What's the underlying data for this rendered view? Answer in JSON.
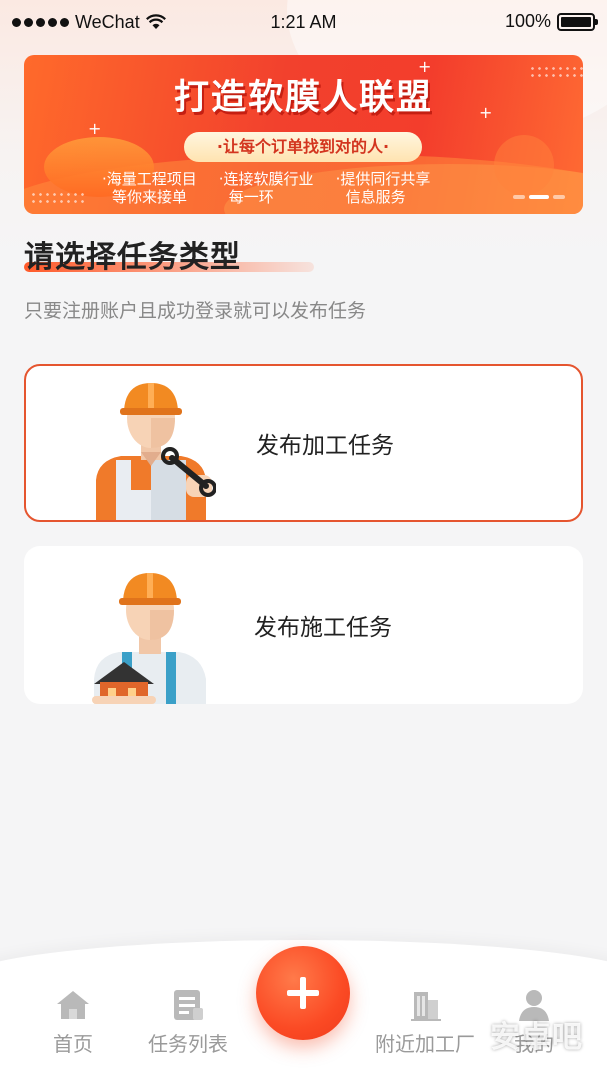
{
  "status_bar": {
    "carrier": "WeChat",
    "time": "1:21 AM",
    "battery": "100%"
  },
  "banner": {
    "title": "打造软膜人联盟",
    "slogan": "·让每个订单找到对的人·",
    "features": [
      {
        "line1": "·海量工程项目",
        "line2": "等你来接单"
      },
      {
        "line1": "·连接软膜行业",
        "line2": "每一环"
      },
      {
        "line1": "·提供同行共享",
        "line2": "信息服务"
      }
    ]
  },
  "section": {
    "title": "请选择任务类型",
    "subtitle": "只要注册账户且成功登录就可以发布任务"
  },
  "tasks": [
    {
      "label": "发布加工任务",
      "icon": "worker-wrench-icon",
      "selected": true
    },
    {
      "label": "发布施工任务",
      "icon": "worker-house-icon",
      "selected": false
    }
  ],
  "bottom_nav": {
    "items": [
      {
        "label": "首页",
        "icon": "home-icon"
      },
      {
        "label": "任务列表",
        "icon": "task-list-icon"
      },
      {
        "label": "附近加工厂",
        "icon": "factory-icon"
      },
      {
        "label": "我的",
        "icon": "profile-icon"
      }
    ],
    "fab_icon": "plus-icon"
  },
  "watermark": "安卓吧",
  "colors": {
    "accent": "#f34a26",
    "selected_border": "#e5552f"
  }
}
